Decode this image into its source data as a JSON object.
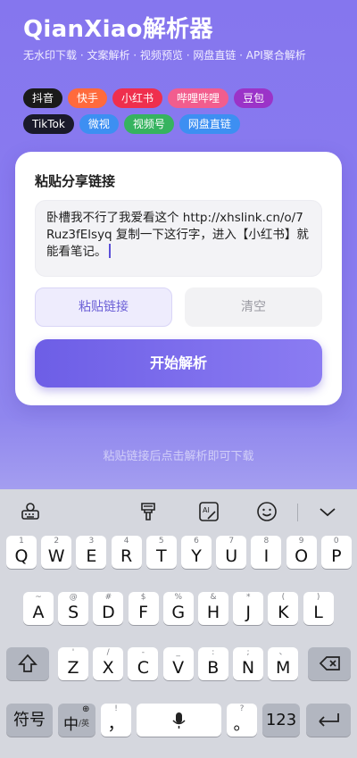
{
  "app": {
    "title": "QianXiao解析器",
    "subtitle": "无水印下载 · 文案解析 · 视频预览 · 网盘直链 · API聚合解析"
  },
  "platform_chips": [
    {
      "label": "抖音",
      "color": "#1a1a1a"
    },
    {
      "label": "快手",
      "color": "#ff6a3c"
    },
    {
      "label": "小红书",
      "color": "#ef2f4d"
    },
    {
      "label": "哔哩哔哩",
      "color": "#f25d8e"
    },
    {
      "label": "豆包",
      "color": "#9b33c8"
    },
    {
      "label": "TikTok",
      "color": "#1a1a2a"
    },
    {
      "label": "微视",
      "color": "#3d8ff2"
    },
    {
      "label": "视频号",
      "color": "#36b35f"
    },
    {
      "label": "网盘直链",
      "color": "#3d8ff2"
    }
  ],
  "card": {
    "title": "粘贴分享链接",
    "input_value": "卧槽我不行了我爱看这个 http://xhslink.cn/o/7Ruz3fElsyq 复制一下这行字，进入【小红书】就能看笔记。",
    "paste_button": "粘贴链接",
    "clear_button": "清空",
    "start_button": "开始解析"
  },
  "hint": "粘贴链接后点击解析即可下载",
  "keyboard": {
    "toolbar_icons": [
      "keyboard-settings-icon",
      "text-format-icon",
      "handwriting-icon",
      "emoji-icon",
      "collapse-keyboard-icon"
    ],
    "row1": [
      {
        "k": "Q",
        "s": "1"
      },
      {
        "k": "W",
        "s": "2"
      },
      {
        "k": "E",
        "s": "3"
      },
      {
        "k": "R",
        "s": "4"
      },
      {
        "k": "T",
        "s": "5"
      },
      {
        "k": "Y",
        "s": "6"
      },
      {
        "k": "U",
        "s": "7"
      },
      {
        "k": "I",
        "s": "8"
      },
      {
        "k": "O",
        "s": "9"
      },
      {
        "k": "P",
        "s": "0"
      }
    ],
    "row2": [
      {
        "k": "A",
        "s": "~"
      },
      {
        "k": "S",
        "s": "@"
      },
      {
        "k": "D",
        "s": "#"
      },
      {
        "k": "F",
        "s": "$"
      },
      {
        "k": "G",
        "s": "%"
      },
      {
        "k": "H",
        "s": "&"
      },
      {
        "k": "J",
        "s": "*"
      },
      {
        "k": "K",
        "s": "("
      },
      {
        "k": "L",
        "s": ")"
      }
    ],
    "row3": [
      {
        "k": "Z",
        "s": "'"
      },
      {
        "k": "X",
        "s": "/"
      },
      {
        "k": "C",
        "s": "-"
      },
      {
        "k": "V",
        "s": "_"
      },
      {
        "k": "B",
        "s": ":"
      },
      {
        "k": "N",
        "s": ";"
      },
      {
        "k": "M",
        "s": "、"
      }
    ],
    "symbols_key": "符号",
    "lang_key": "中",
    "lang_key_alt": "/英",
    "comma_key": "，",
    "comma_sub": "!",
    "period_key": "。",
    "period_sub": "?",
    "numbers_key": "123"
  }
}
